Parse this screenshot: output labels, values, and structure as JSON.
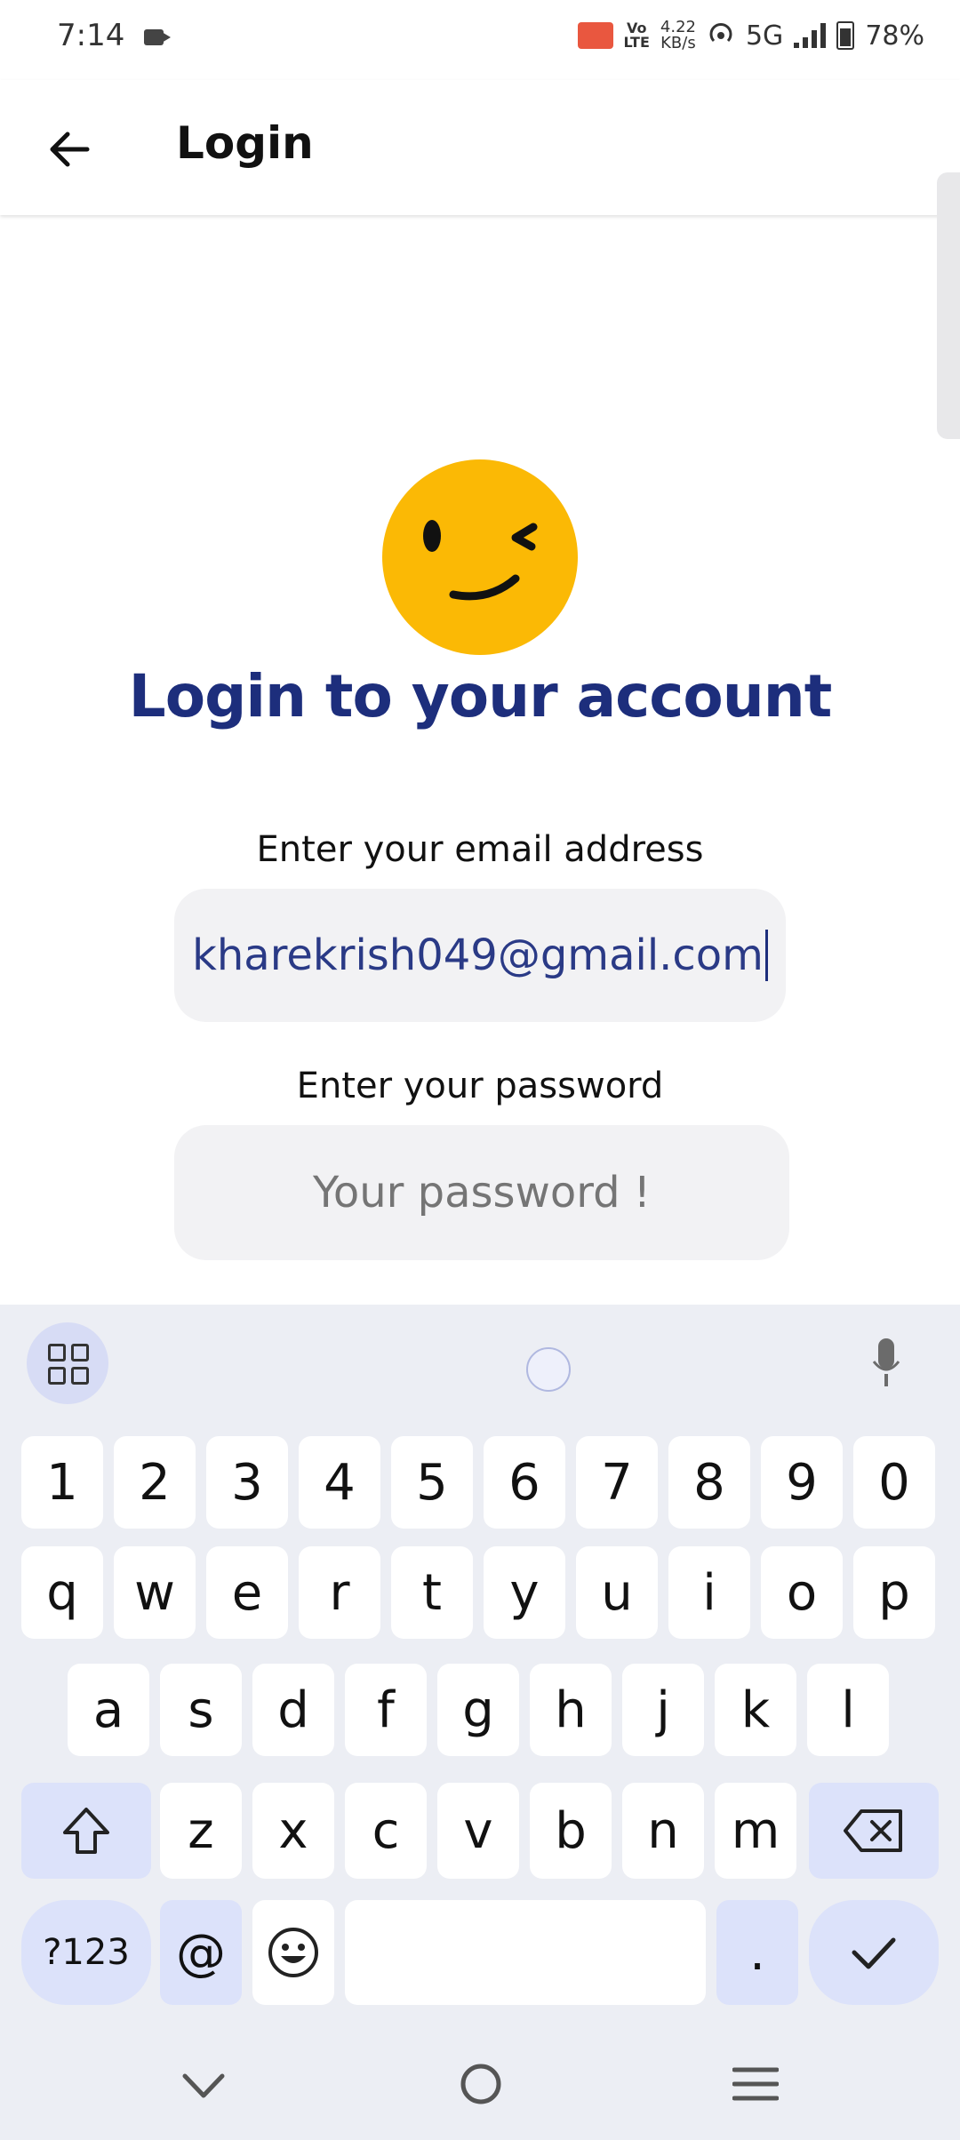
{
  "status_bar": {
    "time": "7:14",
    "volte_label": "Vo\nLTE",
    "speed_value": "4.22",
    "speed_unit": "KB/s",
    "network": "5G",
    "battery": "78%"
  },
  "app_bar": {
    "title": "Login"
  },
  "content": {
    "heading": "Login to your account",
    "email_label": "Enter your email address",
    "email_value": "kharekrish049@gmail.com",
    "password_label": "Enter your password",
    "password_placeholder": "Your password !"
  },
  "keyboard": {
    "number_row": [
      "1",
      "2",
      "3",
      "4",
      "5",
      "6",
      "7",
      "8",
      "9",
      "0"
    ],
    "row1": [
      "q",
      "w",
      "e",
      "r",
      "t",
      "y",
      "u",
      "i",
      "o",
      "p"
    ],
    "row2": [
      "a",
      "s",
      "d",
      "f",
      "g",
      "h",
      "j",
      "k",
      "l"
    ],
    "row3": [
      "z",
      "x",
      "c",
      "v",
      "b",
      "n",
      "m"
    ],
    "symbols_key": "?123",
    "at_key": "@",
    "period_key": "."
  },
  "colors": {
    "brand": "#1d2e7c",
    "emoji": "#fbb905",
    "keyboard_bg": "#eceef4",
    "modifier_key": "#dce2fa"
  }
}
